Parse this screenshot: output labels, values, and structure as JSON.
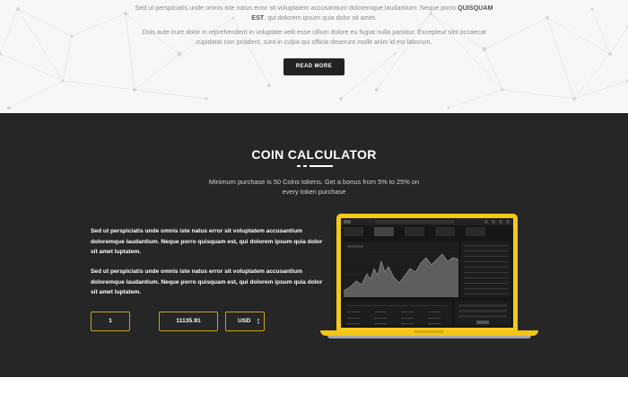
{
  "intro": {
    "para1_pre": "Sed ut perspiciatis unde omnis iste natus error sit voluptatem accusantium doloremque laudantium. Neque porro ",
    "para1_bold": "QUISQUAM EST",
    "para1_post": ", qui dolorem ipsum quia dolor sit amet.",
    "para2": "Duis aute irure dolor in reprehenderit in voluptate velit esse cillum dolore eu fugiat nulla pariatur. Excepteur sint occaecat cupidatat non proident, sunt in culpa qui officia deserunt mollit anim id est laborum.",
    "read_more_label": "READ MORE"
  },
  "calculator": {
    "title": "COIN CALCULATOR",
    "subtitle": "Minimum purchase is 50 Coins tokens. Get a bonus from 5% to 25% on every token purchase",
    "description_1": "Sed ut perspiciatis unde omnis iste natus error sit voluptatem accusantium doloremque laudantium. Neque porro quisquam est, qui dolorem ipsum quia dolor sit amet luptatem.",
    "description_2": "Sed ut perspiciatis unde omnis iste natus error sit voluptatem accusantium doloremque laudantium. Neque porro quisquam est, qui dolorem ipsum quia dolor sit amet luptatem.",
    "quantity_value": "1",
    "amount_value": "11135.91",
    "currency_selected": "USD",
    "select_arrows_icon": "select-arrows-icon"
  },
  "colors": {
    "dark_background": "#262626",
    "accent_yellow": "#f5c91b",
    "field_border": "#c9a21f",
    "button_background": "#222222"
  }
}
